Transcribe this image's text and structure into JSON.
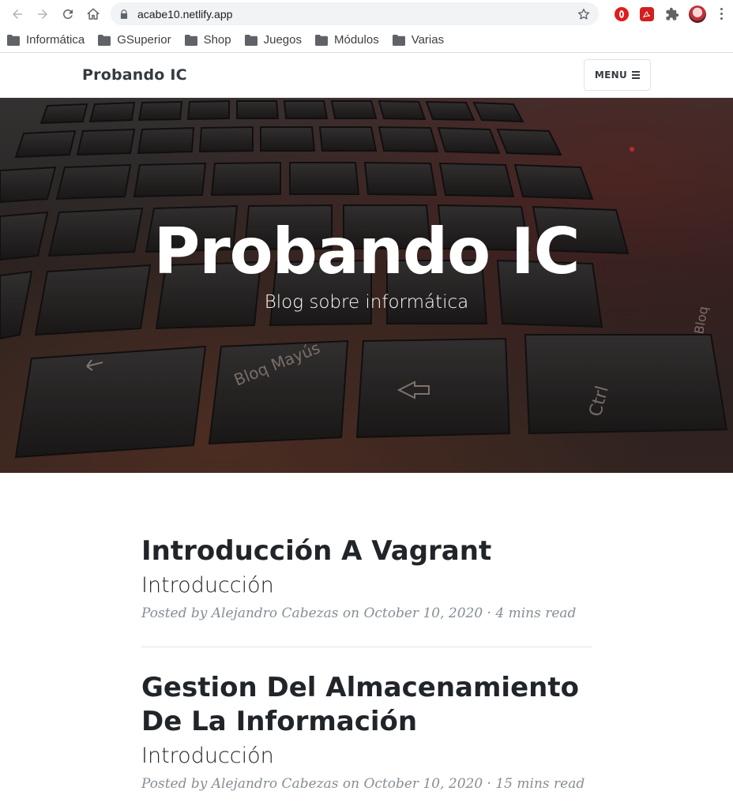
{
  "browser": {
    "url": "acabe10.netlify.app",
    "bookmarks": [
      "Informática",
      "GSuperior",
      "Shop",
      "Juegos",
      "Módulos",
      "Varias"
    ]
  },
  "site": {
    "brand": "Probando IC",
    "menu_label": "MENU"
  },
  "hero": {
    "title": "Probando IC",
    "subtitle": "Blog sobre informática"
  },
  "posts": [
    {
      "title": "Introducción A Vagrant",
      "subtitle": "Introducción",
      "meta": "Posted by Alejandro Cabezas on October 10, 2020 · 4 mins read"
    },
    {
      "title": "Gestion Del Almacenamiento De La Información",
      "subtitle": "Introducción",
      "meta": "Posted by Alejandro Cabezas on October 10, 2020 · 15 mins read"
    }
  ],
  "colors": {
    "heading": "#212529",
    "meta": "#868e96",
    "brand": "#343a40"
  }
}
